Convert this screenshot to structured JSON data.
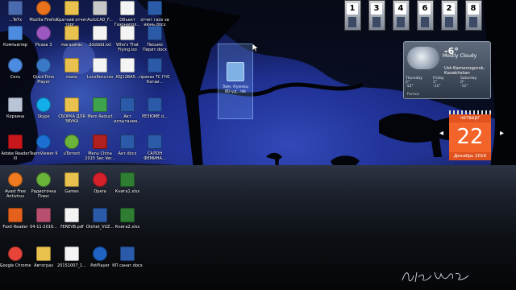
{
  "desktop_icons": [
    {
      "label": "...TeTx",
      "glyph": "app-icon",
      "color": "#4a6bb0"
    },
    {
      "label": "Компьютер",
      "glyph": "computer-icon",
      "color": "#4d8be0"
    },
    {
      "label": "Сеть",
      "glyph": "network-icon",
      "color": "#4d8be0"
    },
    {
      "label": "Корзина",
      "glyph": "recycle-bin-icon",
      "color": "#b9c5d6"
    },
    {
      "label": "Adobe Reader XI",
      "glyph": "adobe-reader-icon",
      "color": "#c8161d"
    },
    {
      "label": "Avast Free Antivirus",
      "glyph": "avast-icon",
      "color": "#f07a1f"
    },
    {
      "label": "Foxit Reader",
      "glyph": "foxit-reader-icon",
      "color": "#e3611b"
    },
    {
      "label": "Google Chrome",
      "glyph": "chrome-icon",
      "color": "#e9443a"
    },
    {
      "label": "Mozilla Firefox",
      "glyph": "firefox-icon",
      "color": "#e8711c"
    },
    {
      "label": "Picasa 3",
      "glyph": "picasa-icon",
      "color": "#9d57c1"
    },
    {
      "label": "QuickTime Player",
      "glyph": "quicktime-icon",
      "color": "#3a78c8"
    },
    {
      "label": "Skype",
      "glyph": "skype-icon",
      "color": "#12aeeb"
    },
    {
      "label": "TeamViewer 9",
      "glyph": "teamviewer-icon",
      "color": "#1b6fd1"
    },
    {
      "label": "Радиоточка Плюс",
      "glyph": "radio-icon",
      "color": "#6ab43a"
    },
    {
      "label": "04-11-2016...",
      "glyph": "image-file-icon",
      "color": "#b84f6f"
    },
    {
      "label": "Автограз",
      "glyph": "folder-icon",
      "color": "#e8c14f"
    },
    {
      "label": "Краткий отчет торг...",
      "glyph": "folder-icon",
      "color": "#e8c14f"
    },
    {
      "label": "магазины",
      "glyph": "folder-icon",
      "color": "#e8c14f"
    },
    {
      "label": "мама",
      "glyph": "folder-icon",
      "color": "#e8c14f"
    },
    {
      "label": "СБОРКА ДЛЯ ЗВУКА",
      "glyph": "folder-icon",
      "color": "#e8c14f"
    },
    {
      "label": "uTorrent",
      "glyph": "utorrent-icon",
      "color": "#6bb33a"
    },
    {
      "label": "Games",
      "glyph": "folder-icon",
      "color": "#e8c14f"
    },
    {
      "label": "7EREVB.pdf",
      "glyph": "pdf-file-icon",
      "color": "#f4f4f4"
    },
    {
      "label": "20151007_1...",
      "glyph": "document-file-icon",
      "color": "#f4f4f4"
    },
    {
      "label": "AutoCAD_F...",
      "glyph": "autocad-file-icon",
      "color": "#c8c8c8"
    },
    {
      "label": "dddddd.txt",
      "glyph": "text-file-icon",
      "color": "#f4f4f4"
    },
    {
      "label": "LocoRoco.iso",
      "glyph": "iso-file-icon",
      "color": "#f4f4f4"
    },
    {
      "label": "Mem Reduct",
      "glyph": "mem-reduct-icon",
      "color": "#3fa34d"
    },
    {
      "label": "Menu China 2015 Sec Ver...",
      "glyph": "menu-china-icon",
      "color": "#b0201e"
    },
    {
      "label": "Opera",
      "glyph": "opera-icon",
      "color": "#d6202a"
    },
    {
      "label": "Otchet_VUZ...",
      "glyph": "word-file-icon",
      "color": "#2a5aa8"
    },
    {
      "label": "PotPlayer",
      "glyph": "potplayer-icon",
      "color": "#1f63c4"
    },
    {
      "label": "Объект Газонапол...",
      "glyph": "document-file-icon",
      "color": "#f4f4f4"
    },
    {
      "label": "Who's That Flying.iso",
      "glyph": "iso-file-icon",
      "color": "#f4f4f4"
    },
    {
      "label": "ASJ12BA5...",
      "glyph": "archive-file-icon",
      "color": "#f4f4f4"
    },
    {
      "label": "Акт испытания...",
      "glyph": "word-file-icon",
      "color": "#2a5aa8"
    },
    {
      "label": "Акт.docx",
      "glyph": "word-file-icon",
      "color": "#2a5aa8"
    },
    {
      "label": "Книга1.xlsx",
      "glyph": "excel-file-icon",
      "color": "#2e7d32"
    },
    {
      "label": "Книга2.xlsx",
      "glyph": "excel-file-icon",
      "color": "#2e7d32"
    },
    {
      "label": "КП санат.docx",
      "glyph": "word-file-icon",
      "color": "#2a5aa8"
    },
    {
      "label": "отчет гасе за июнь.docx",
      "glyph": "word-file-icon",
      "color": "#2a5aa8"
    },
    {
      "label": "Письмо Пирит.docx",
      "glyph": "word-file-icon",
      "color": "#2a5aa8"
    },
    {
      "label": "приказ ТС ГНС Катаи...",
      "glyph": "word-file-icon",
      "color": "#2a5aa8"
    },
    {
      "label": "РЕЗЮМЕ.d...",
      "glyph": "word-file-icon",
      "color": "#2a5aa8"
    },
    {
      "label": "САЛОН ФЕМИНА...",
      "glyph": "word-file-icon",
      "color": "#2a5aa8"
    }
  ],
  "drag_ghost": {
    "label": "Зам. Кузнец 80-уд...isk"
  },
  "pin_strip": {
    "numbers": [
      "1",
      "3",
      "4",
      "6",
      "2",
      "8"
    ]
  },
  "weather": {
    "temp": "-6°",
    "condition": "Mostly Cloudy",
    "location": "Ust-Kamenogorsk, Kazakhstan",
    "days": [
      {
        "name": "Thursday",
        "hi": "2°",
        "lo": "-12°"
      },
      {
        "name": "Friday",
        "hi": "1°",
        "lo": "-11°"
      },
      {
        "name": "Saturday",
        "hi": "0°",
        "lo": "-11°"
      }
    ],
    "source": "Foreca"
  },
  "calendar": {
    "weekday": "четверг",
    "day": "22",
    "month_year": "Декабрь 2016"
  },
  "side_arrows": {
    "left": "◂",
    "right": "▸"
  }
}
